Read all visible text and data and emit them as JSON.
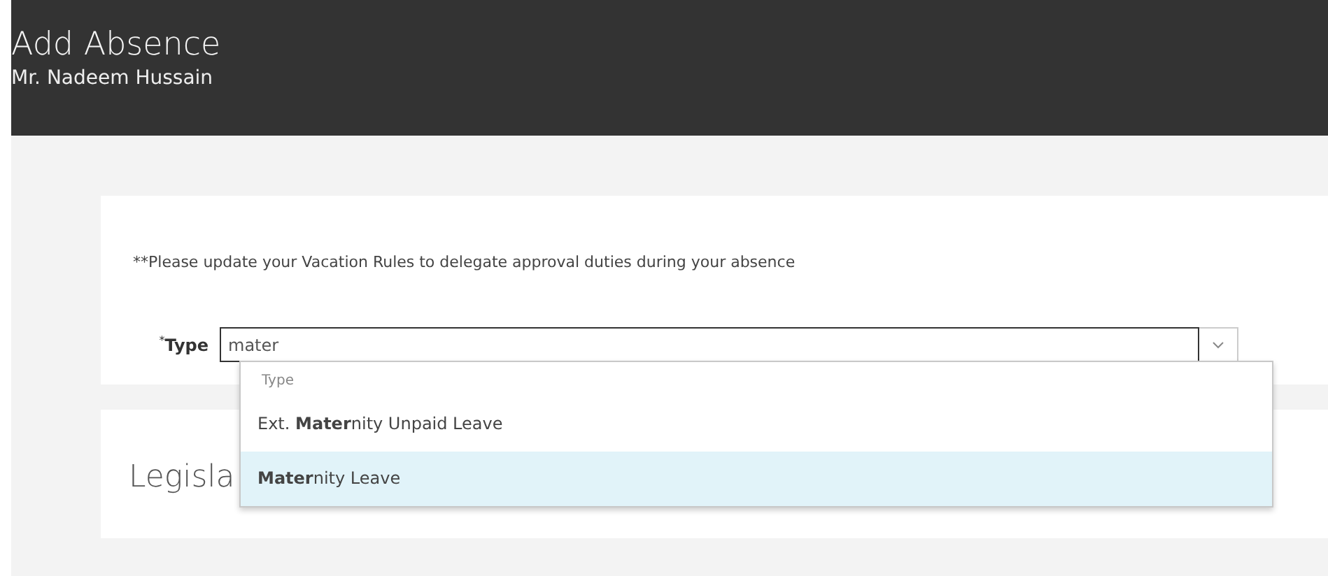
{
  "header": {
    "title": "Add Absence",
    "subtitle": "Mr. Nadeem Hussain"
  },
  "notice": "**Please update your Vacation Rules to delegate approval duties during your absence",
  "type_field": {
    "label": "$^{*}$**Type**",
    "value": "mater",
    "expanded": true
  },
  "dropdown": {
    "heading": "Type",
    "options": [
      {
        "label": "Ext. **Mater**nity Unpaid Leave",
        "selected": false
      },
      {
        "label": "**Mater**nity Leave",
        "selected": true
      }
    ]
  },
  "section": {
    "title": "Legisla"
  }
}
